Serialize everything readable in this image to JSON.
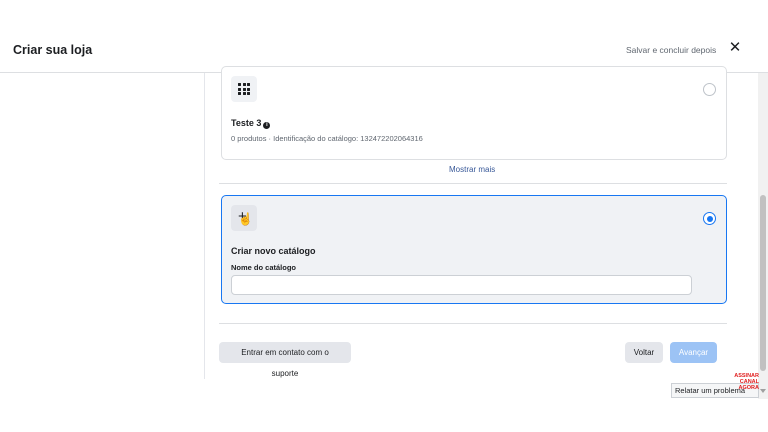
{
  "header": {
    "title": "Criar sua loja",
    "save_and_finish": "Salvar e concluir depois",
    "close_glyph": "✕"
  },
  "catalog_card": {
    "name": "Teste 3",
    "info_glyph": "i",
    "meta": "0 produtos · Identificação do catálogo: 132472202064316",
    "selected": false,
    "icon": "grid-icon"
  },
  "show_more": "Mostrar mais",
  "new_catalog": {
    "icon_glyph": "+",
    "title": "Criar novo catálogo",
    "field_label": "Nome do catálogo",
    "field_value": "",
    "selected": true
  },
  "cursor_glyph": "☝",
  "footer": {
    "support_button": "Entrar em contato com o suporte",
    "back_button": "Voltar",
    "next_button": "Avançar"
  },
  "report_problem": "Relatar um problema",
  "watermark": "ASSINAR CANAL AGORA",
  "colors": {
    "accent": "#1877f2",
    "next_disabled": "#9cc3f5",
    "link": "#385898"
  }
}
